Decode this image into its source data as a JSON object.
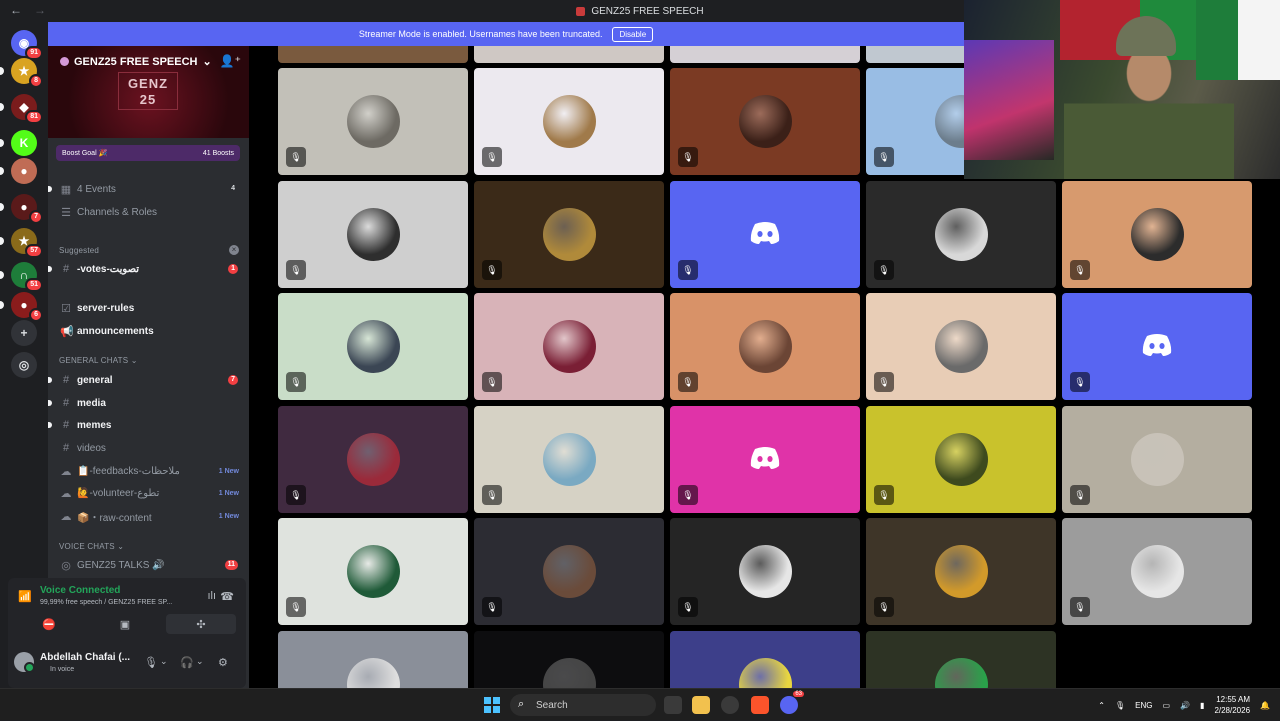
{
  "window": {
    "title": "GENZ25 FREE SPEECH"
  },
  "banner": {
    "text": "Streamer Mode is enabled. Usernames have been truncated.",
    "button": "Disable"
  },
  "rail": {
    "servers": [
      {
        "name": "discord-home",
        "badge": "91",
        "color": "#5865f2",
        "glyph": "◉"
      },
      {
        "name": "server-star",
        "badge": "8",
        "color": "#d9a321",
        "glyph": "★"
      },
      {
        "name": "server-red",
        "badge": "81",
        "color": "#7a1c1c",
        "glyph": "◆"
      },
      {
        "name": "kick",
        "badge": "",
        "color": "#53fc18",
        "glyph": "K"
      },
      {
        "name": "server-avatar",
        "badge": "",
        "color": "#c06c55",
        "glyph": "●"
      },
      {
        "name": "server-dark",
        "badge": "7",
        "color": "#5a1a1a",
        "glyph": "●"
      },
      {
        "name": "server-gold",
        "badge": "57",
        "color": "#8a6a1a",
        "glyph": "★"
      },
      {
        "name": "server-green",
        "badge": "51",
        "color": "#1e7d3a",
        "glyph": "∩"
      },
      {
        "name": "server-red2",
        "badge": "6",
        "color": "#8a1c1c",
        "glyph": "●"
      }
    ]
  },
  "sidebar": {
    "server_name": "GENZ25 FREE SPEECH",
    "logo_text": "GENZ 25",
    "boost": {
      "label": "Boost Goal 🎉",
      "count": "41 Boosts"
    },
    "events": {
      "label": "4 Events",
      "count": "4"
    },
    "channels_roles": "Channels & Roles",
    "suggested_label": "Suggested",
    "votes_channel": {
      "label": "-votes-تصويت",
      "count": "1"
    },
    "server_rules": "server-rules",
    "announcements": "announcements",
    "general_chats_label": "GENERAL CHATS ⌄",
    "general": {
      "label": "general",
      "count": "7"
    },
    "media": "media",
    "memes": "memes",
    "videos": "videos",
    "feedbacks": {
      "label": "📋-feedbacks-ملاحظات",
      "new": "1 New"
    },
    "volunteer": {
      "label": "🙋-volunteer-تطوع",
      "new": "1 New"
    },
    "raw_content": {
      "label": "📦・raw-content",
      "new": "1 New"
    },
    "voice_chats_label": "VOICE CHATS ⌄",
    "talks": {
      "label": "GENZ25 TALKS 🔊",
      "count": "11"
    }
  },
  "voice": {
    "status": "Voice Connected",
    "channel": "99,99% free speech / GENZ25 FREE SP...",
    "user": "Abdellah Chafai (...",
    "user_status": "In voice"
  },
  "grid": {
    "tiles": [
      {
        "bg": "#c2c0b8",
        "avatar": "#6d6a63",
        "kind": "avatar"
      },
      {
        "bg": "#ece9ef",
        "avatar": "#a07a4a",
        "kind": "avatar"
      },
      {
        "bg": "#7b3a23",
        "avatar": "#3b2018",
        "kind": "avatar"
      },
      {
        "bg": "#99bde4",
        "avatar": "#6c7d8c",
        "kind": "avatar"
      },
      {
        "bg": "#141a26",
        "avatar": "#334a66",
        "kind": "avatar"
      },
      {
        "bg": "#cfcfcf",
        "avatar": "#2e2e2e",
        "kind": "avatar"
      },
      {
        "bg": "#3b2a18",
        "avatar": "#b08a3a",
        "kind": "avatar"
      },
      {
        "bg": "#5865f2",
        "avatar": "",
        "kind": "discord"
      },
      {
        "bg": "#2a2a2a",
        "avatar": "#d8d8d8",
        "kind": "avatar"
      },
      {
        "bg": "#d79a6e",
        "avatar": "#2c2c2c",
        "kind": "avatar"
      },
      {
        "bg": "#c9ddc8",
        "avatar": "#3b4654",
        "kind": "avatar"
      },
      {
        "bg": "#d8b3b8",
        "avatar": "#7a1f35",
        "kind": "avatar"
      },
      {
        "bg": "#d89268",
        "avatar": "#6b4535",
        "kind": "avatar"
      },
      {
        "bg": "#e8cdb6",
        "avatar": "#6a6a6a",
        "kind": "avatar"
      },
      {
        "bg": "#5865f2",
        "avatar": "",
        "kind": "discord"
      },
      {
        "bg": "#402a40",
        "avatar": "#9a2a3a",
        "kind": "avatar"
      },
      {
        "bg": "#d6d2c5",
        "avatar": "#7aa9c2",
        "kind": "avatar"
      },
      {
        "bg": "#e033a8",
        "avatar": "",
        "kind": "discord"
      },
      {
        "bg": "#c9c22c",
        "avatar": "#3e4a1e",
        "kind": "avatar"
      },
      {
        "bg": "#b4aea0",
        "avatar": "#c8c2b8",
        "kind": "avatar"
      },
      {
        "bg": "#dfe3de",
        "avatar": "#1f5a38",
        "kind": "avatar"
      },
      {
        "bg": "#2c2c33",
        "avatar": "#6a4b3a",
        "kind": "avatar"
      },
      {
        "bg": "#252525",
        "avatar": "#e6e6e6",
        "kind": "avatar"
      },
      {
        "bg": "#3e3528",
        "avatar": "#d29a2a",
        "kind": "avatar"
      },
      {
        "bg": "#9c9c9c",
        "avatar": "#e6e6e6",
        "kind": "avatar"
      },
      {
        "bg": "#8a8f99",
        "avatar": "#dedede",
        "kind": "avatar"
      },
      {
        "bg": "#0d0d0f",
        "avatar": "#444",
        "kind": "avatar"
      },
      {
        "bg": "#3d3f8a",
        "avatar": "#e8d640",
        "kind": "avatar"
      },
      {
        "bg": "#2d3324",
        "avatar": "#2aa14a",
        "kind": "avatar"
      }
    ]
  },
  "taskbar": {
    "search": "Search",
    "lang": "ENG",
    "time": "12:55 AM",
    "date": "2/28/2026",
    "discord_badge": "63"
  }
}
